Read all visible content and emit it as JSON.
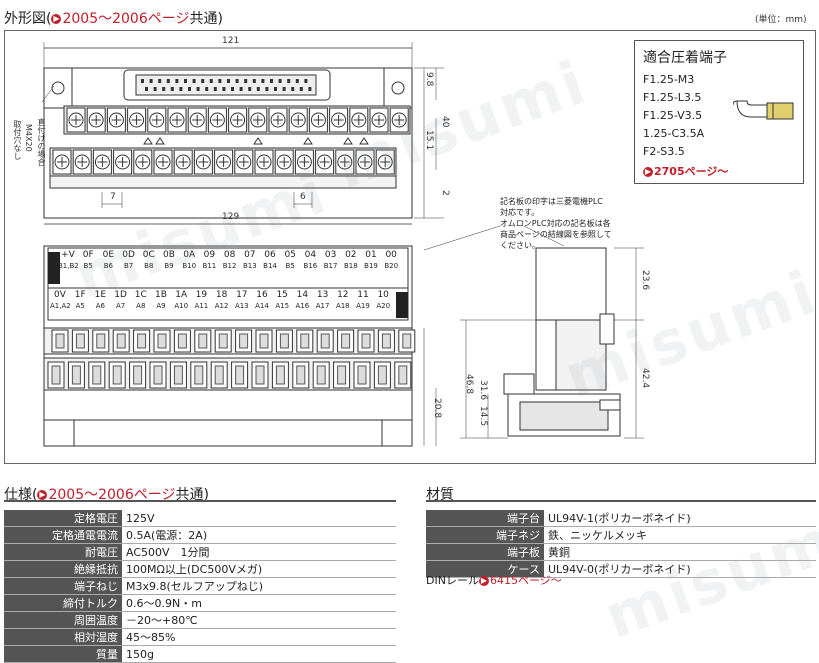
{
  "header": {
    "title_prefix": "外形図(",
    "title_link": "2005～2006ページ",
    "title_suffix": "共通)",
    "unit": "(単位：mm)"
  },
  "dimensions": {
    "top_width": "121",
    "bottom_width": "129",
    "pitch_a": "7",
    "pitch_b": "6",
    "h_98": "9.8",
    "h_40": "40",
    "h_151": "15.1",
    "h_2": "2",
    "h_236": "23.6",
    "h_468": "46.8",
    "h_424": "42.4",
    "h_316": "31.6",
    "h_208": "20.8",
    "h_145": "14.5",
    "screw_note_1": "直付けの場合",
    "screw_note_2": "M4X20",
    "screw_note_3": "取付穴なし"
  },
  "terminals": {
    "title": "適合圧着端子",
    "items": [
      "F1.25-M3",
      "F1.25-L3.5",
      "F1.25-V3.5",
      "1.25-C3.5A",
      "F2-S3.5"
    ],
    "link": "2705ページ～"
  },
  "note": {
    "lines": [
      "記名板の印字は三菱電機PLC",
      "対応です。",
      "オムロンPLC対応の記名板は各",
      "商品ページの結線図を参照して",
      "ください。"
    ]
  },
  "top_row": {
    "labels": [
      "+V",
      "0F",
      "0E",
      "0D",
      "0C",
      "0B",
      "0A",
      "09",
      "08",
      "07",
      "06",
      "05",
      "04",
      "03",
      "02",
      "01",
      "00"
    ],
    "pins": [
      "B1,B2",
      "B5",
      "B6",
      "B7",
      "B8",
      "B9",
      "B10",
      "B11",
      "B12",
      "B13",
      "B14",
      "B5",
      "B16",
      "B17",
      "B18",
      "B19",
      "B20"
    ]
  },
  "bottom_row": {
    "labels": [
      "0V",
      "1F",
      "1E",
      "1D",
      "1C",
      "1B",
      "1A",
      "19",
      "18",
      "17",
      "16",
      "15",
      "14",
      "13",
      "12",
      "11",
      "10"
    ],
    "pins": [
      "A1,A2",
      "A5",
      "A6",
      "A7",
      "A8",
      "A9",
      "A10",
      "A11",
      "A12",
      "A13",
      "A14",
      "A15",
      "A16",
      "A17",
      "A18",
      "A19",
      "A20"
    ]
  },
  "spec": {
    "title_prefix": "仕様(",
    "title_link": "2005～2006ページ",
    "title_suffix": "共通)",
    "rows": [
      {
        "label": "定格電圧",
        "value": "125V"
      },
      {
        "label": "定格通電電流",
        "value": "0.5A(電源：2A)"
      },
      {
        "label": "耐電圧",
        "value": "AC500V　1分間"
      },
      {
        "label": "絶縁抵抗",
        "value": "100MΩ以上(DC500Vメガ)"
      },
      {
        "label": "端子ねじ",
        "value": "M3x9.8(セルフアップねじ)"
      },
      {
        "label": "締付トルク",
        "value": "0.6～0.9N・m"
      },
      {
        "label": "周囲温度",
        "value": "－20～+80℃"
      },
      {
        "label": "相対湿度",
        "value": "45～85%"
      },
      {
        "label": "質量",
        "value": "150g"
      }
    ]
  },
  "material": {
    "title": "材質",
    "rows": [
      {
        "label": "端子台",
        "value": "UL94V-1(ポリカーボネイド)"
      },
      {
        "label": "端子ネジ",
        "value": "鉄、ニッケルメッキ"
      },
      {
        "label": "端子板",
        "value": "黄銅"
      },
      {
        "label": "ケース",
        "value": "UL94V-0(ポリカーボネイド)"
      }
    ],
    "din_prefix": "DINレール",
    "din_link": "6415ページ～"
  },
  "watermark": "misumi"
}
